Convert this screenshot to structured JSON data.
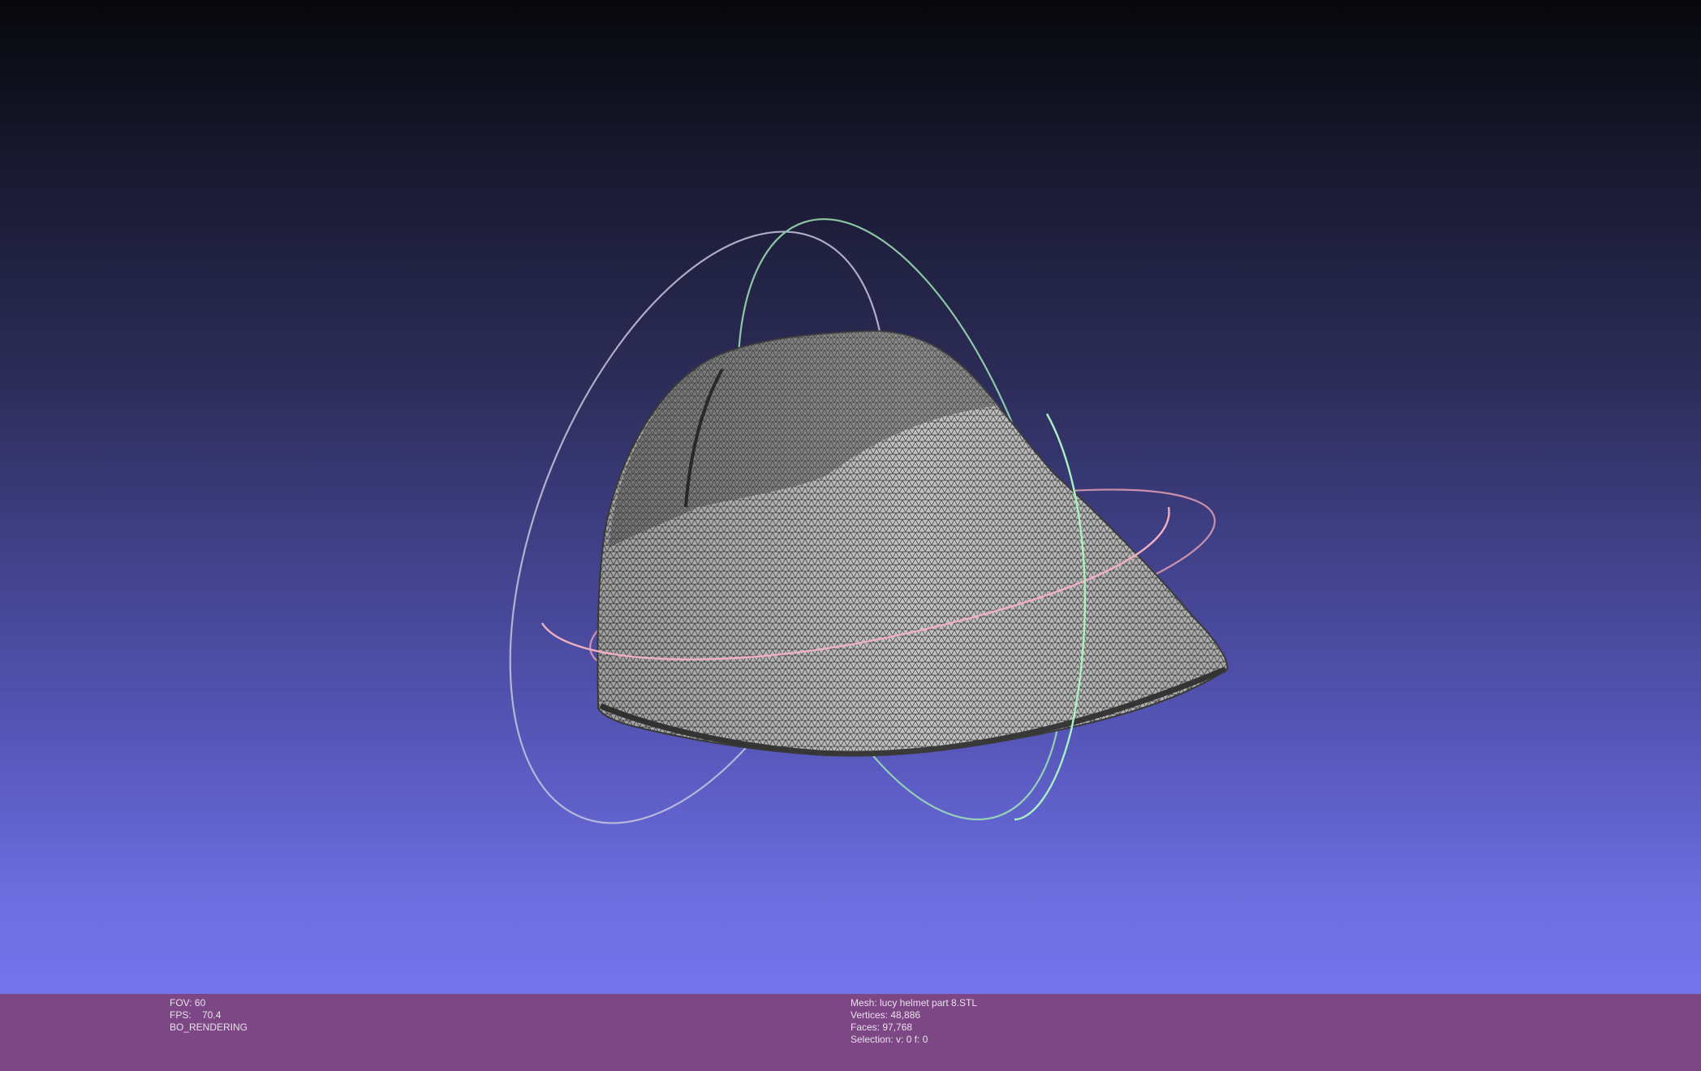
{
  "viewport": {
    "label": "MeshLab 3D viewport",
    "trackball_colors": {
      "ring_x": "#cfcfe6",
      "ring_y": "#9fe8b8",
      "ring_z": "#e6a3b5"
    },
    "mesh_color": "#bdbdbd",
    "wire_color": "#4a4a4a"
  },
  "info_left": {
    "fov": "FOV: 60",
    "fps": "FPS:    70.4",
    "mode": "BO_RENDERING"
  },
  "info_right": {
    "mesh": "Mesh: lucy helmet part 8.STL",
    "vertices": "Vertices: 48,886",
    "faces": "Faces: 97,768",
    "selection": "Selection: v: 0 f: 0"
  },
  "colors": {
    "info_bar_bg": "#7d4684",
    "gradient_top": "#07070b",
    "gradient_bottom": "#7474ec"
  }
}
